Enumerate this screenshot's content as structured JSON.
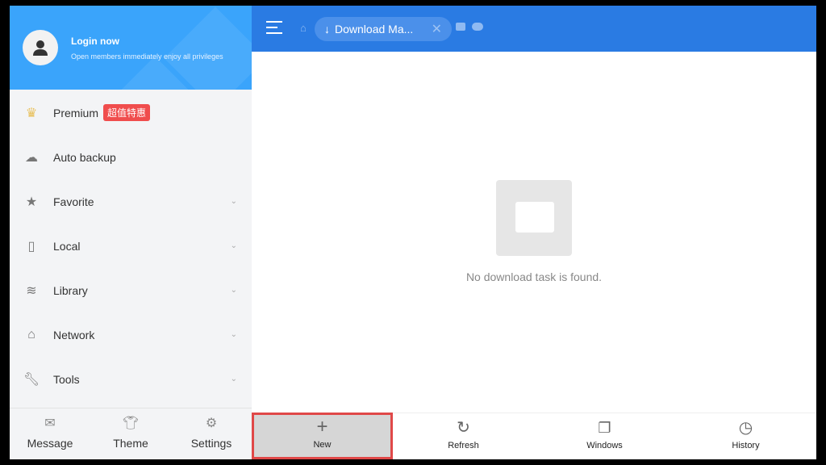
{
  "profile": {
    "title": "Login now",
    "subtitle": "Open members immediately enjoy all privileges"
  },
  "sidebar": {
    "items": [
      {
        "label": "Premium",
        "icon": "crown-icon",
        "badge": "超值特惠"
      },
      {
        "label": "Auto backup",
        "icon": "cloud-icon"
      },
      {
        "label": "Favorite",
        "icon": "star-icon"
      },
      {
        "label": "Local",
        "icon": "phone-icon"
      },
      {
        "label": "Library",
        "icon": "layers-icon"
      },
      {
        "label": "Network",
        "icon": "router-icon"
      },
      {
        "label": "Tools",
        "icon": "wrench-icon"
      }
    ],
    "bottom": [
      {
        "label": "Message"
      },
      {
        "label": "Theme"
      },
      {
        "label": "Settings"
      }
    ]
  },
  "topbar": {
    "tab_label": "Download Ma..."
  },
  "main": {
    "empty_text": "No download task is found."
  },
  "toolbar": [
    {
      "label": "New"
    },
    {
      "label": "Refresh"
    },
    {
      "label": "Windows"
    },
    {
      "label": "History"
    }
  ],
  "colors": {
    "header": "#3aa4fb",
    "topbar": "#2a7be3",
    "badge": "#f04d4d",
    "highlight": "#e04848"
  }
}
